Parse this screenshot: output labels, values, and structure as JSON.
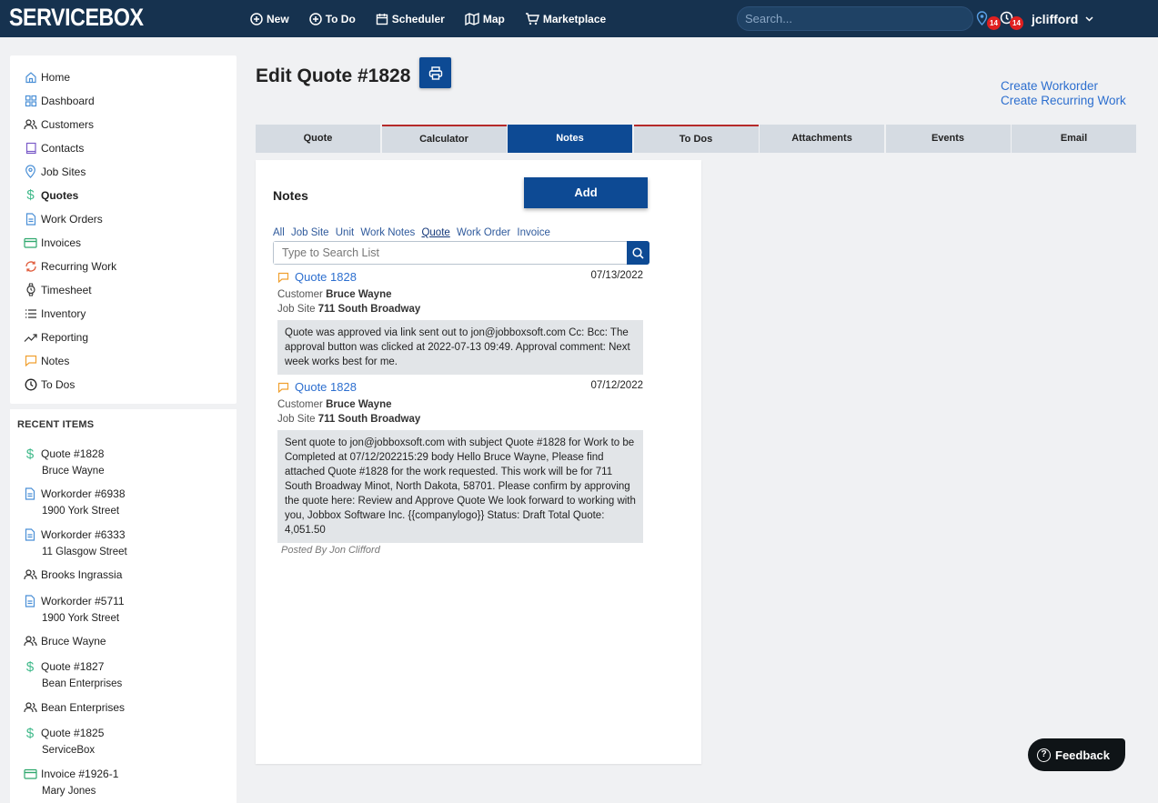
{
  "brand": "SERVICEBOX",
  "topnav": [
    {
      "label": "New",
      "icon": "plus-circle-icon"
    },
    {
      "label": "To Do",
      "icon": "plus-circle-icon"
    },
    {
      "label": "Scheduler",
      "icon": "calendar-icon"
    },
    {
      "label": "Map",
      "icon": "map-icon"
    },
    {
      "label": "Marketplace",
      "icon": "cart-icon"
    }
  ],
  "search": {
    "placeholder": "Search..."
  },
  "badges": {
    "location": "14",
    "clock": "14"
  },
  "user": {
    "name": "jclifford"
  },
  "sidebar": {
    "items": [
      {
        "label": "Home",
        "icon": "home-icon"
      },
      {
        "label": "Dashboard",
        "icon": "dashboard-icon"
      },
      {
        "label": "Customers",
        "icon": "users-icon"
      },
      {
        "label": "Contacts",
        "icon": "contact-icon"
      },
      {
        "label": "Job Sites",
        "icon": "map-pin-icon"
      },
      {
        "label": "Quotes",
        "icon": "dollar-icon"
      },
      {
        "label": "Work Orders",
        "icon": "document-icon"
      },
      {
        "label": "Invoices",
        "icon": "credit-card-icon"
      },
      {
        "label": "Recurring Work",
        "icon": "refresh-icon"
      },
      {
        "label": "Timesheet",
        "icon": "watch-icon"
      },
      {
        "label": "Inventory",
        "icon": "list-icon"
      },
      {
        "label": "Reporting",
        "icon": "trend-icon"
      },
      {
        "label": "Notes",
        "icon": "chat-icon"
      },
      {
        "label": "To Dos",
        "icon": "clock-icon"
      }
    ]
  },
  "recent": {
    "title": "RECENT ITEMS",
    "items": [
      {
        "title": "Quote #1828",
        "sub": "Bruce Wayne",
        "icon": "dollar-icon"
      },
      {
        "title": "Workorder #6938",
        "sub": "1900 York Street",
        "icon": "document-icon"
      },
      {
        "title": "Workorder #6333",
        "sub": "11 Glasgow Street",
        "icon": "document-icon"
      },
      {
        "title": "Brooks Ingrassia",
        "sub": "",
        "icon": "users-icon"
      },
      {
        "title": "Workorder #5711",
        "sub": "1900 York Street",
        "icon": "document-icon"
      },
      {
        "title": "Bruce Wayne",
        "sub": "",
        "icon": "users-icon"
      },
      {
        "title": "Quote #1827",
        "sub": "Bean Enterprises",
        "icon": "dollar-icon"
      },
      {
        "title": "Bean Enterprises",
        "sub": "",
        "icon": "users-icon"
      },
      {
        "title": "Quote #1825",
        "sub": "ServiceBox",
        "icon": "dollar-icon"
      },
      {
        "title": "Invoice #1926-1",
        "sub": "Mary Jones",
        "icon": "credit-card-icon"
      }
    ]
  },
  "page": {
    "title": "Edit Quote #1828",
    "links": [
      "Create Workorder",
      "Create Recurring Work"
    ]
  },
  "tabs": [
    "Quote",
    "Calculator",
    "Notes",
    "To Dos",
    "Attachments",
    "Events",
    "Email"
  ],
  "notes": {
    "title": "Notes",
    "add_label": "Add",
    "filters": [
      "All",
      "Job Site",
      "Unit",
      "Work Notes",
      "Quote",
      "Work Order",
      "Invoice"
    ],
    "search_placeholder": "Type to Search List",
    "customer_label": "Customer",
    "jobsite_label": "Job Site",
    "entries": [
      {
        "title": "Quote 1828",
        "date": "07/13/2022",
        "customer": "Bruce Wayne",
        "jobsite": "711 South Broadway",
        "body": "Quote was approved via link sent out to jon@jobboxsoft.com Cc: Bcc: The approval button was clicked at 2022-07-13 09:49. Approval comment: Next week works best for me.",
        "posted": ""
      },
      {
        "title": "Quote 1828",
        "date": "07/12/2022",
        "customer": "Bruce Wayne",
        "jobsite": "711 South Broadway",
        "body": "Sent quote to jon@jobboxsoft.com with subject Quote #1828 for Work to be Completed at 07/12/202215:29 body Hello Bruce Wayne, Please find attached Quote #1828 for the work requested. This work will be for 711 South Broadway Minot, North Dakota, 58701. Please confirm by approving the quote here: Review and Approve Quote We look forward to working with you, Jobbox Software Inc. {{companylogo}} Status: Draft Total Quote: 4,051.50",
        "posted": "Posted By Jon Clifford"
      }
    ]
  },
  "feedback": {
    "label": "Feedback"
  },
  "colors": {
    "topbar": "#16324f",
    "primary": "#0d4a94",
    "link": "#2d6fcf",
    "badge": "#e02020"
  }
}
